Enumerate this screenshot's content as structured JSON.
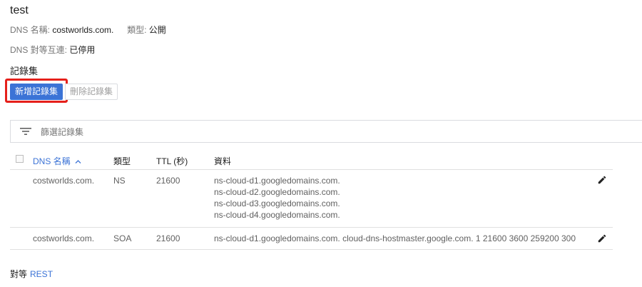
{
  "zone": {
    "title": "test",
    "dns_name_label": "DNS 名稱:",
    "dns_name_value": "costworlds.com.",
    "type_label": "類型:",
    "type_value": "公開",
    "peering_label": "DNS 對等互連:",
    "peering_value": "已停用"
  },
  "record_sets": {
    "section_title": "記錄集",
    "add_button": "新增記錄集",
    "delete_button": "刪除記錄集",
    "filter_placeholder": "篩選記錄集"
  },
  "table": {
    "columns": {
      "dns_name": "DNS 名稱",
      "sort_indicator": "^",
      "type": "類型",
      "ttl": "TTL (秒)",
      "data": "資料"
    },
    "rows": [
      {
        "dns_name": "costworlds.com.",
        "type": "NS",
        "ttl": "21600",
        "data": [
          "ns-cloud-d1.googledomains.com.",
          "ns-cloud-d2.googledomains.com.",
          "ns-cloud-d3.googledomains.com.",
          "ns-cloud-d4.googledomains.com."
        ]
      },
      {
        "dns_name": "costworlds.com.",
        "type": "SOA",
        "ttl": "21600",
        "data": [
          "ns-cloud-d1.googledomains.com. cloud-dns-hostmaster.google.com. 1 21600 3600 259200 300"
        ]
      }
    ]
  },
  "footer": {
    "label": "對等",
    "link": "REST"
  },
  "icons": {
    "filter": "filter-icon",
    "edit": "pencil-icon"
  },
  "colors": {
    "primary": "#3b73d6",
    "highlight": "#e5201b"
  }
}
